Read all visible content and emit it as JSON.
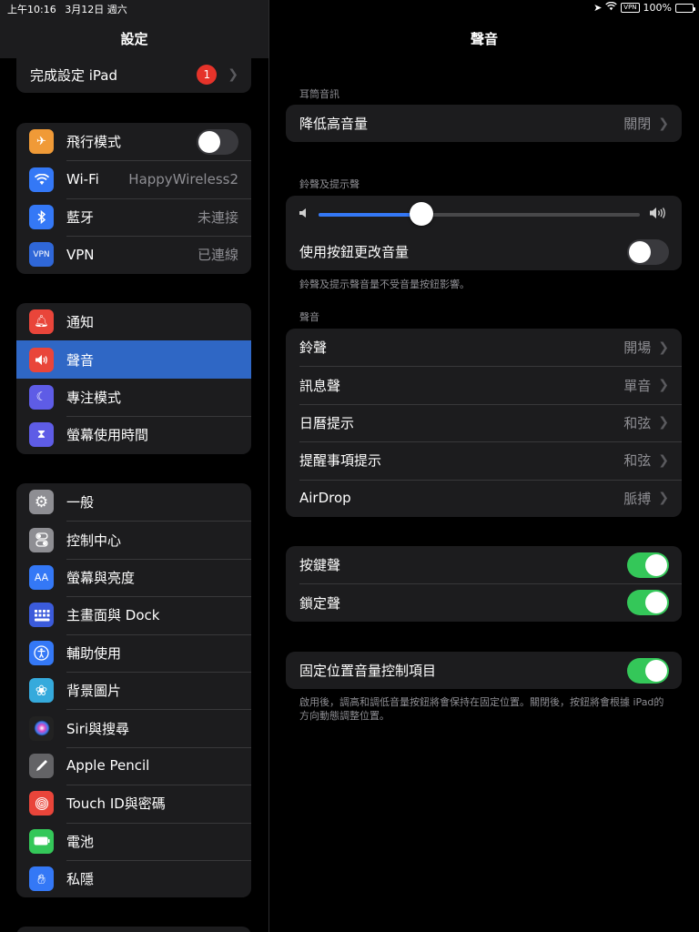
{
  "status": {
    "time": "上午10:16",
    "date": "3月12日 週六",
    "vpn": "VPN",
    "battery": "100%"
  },
  "sidebar": {
    "title": "設定",
    "setup": {
      "label": "完成設定 iPad",
      "badge": "1"
    },
    "group1": [
      {
        "label": "飛行模式",
        "icon": "airplane-icon",
        "color": "#f09a37",
        "toggle": false
      },
      {
        "label": "Wi-Fi",
        "icon": "wifi-icon",
        "color": "#3478f6",
        "value": "HappyWireless2"
      },
      {
        "label": "藍牙",
        "icon": "bluetooth-icon",
        "color": "#3478f6",
        "value": "未連接"
      },
      {
        "label": "VPN",
        "icon": "vpn-icon",
        "color": "#2f67d8",
        "value": "已連線",
        "icon_text": "VPN"
      }
    ],
    "group2": [
      {
        "label": "通知",
        "icon": "bell-icon",
        "color": "#e9453a"
      },
      {
        "label": "聲音",
        "icon": "speaker-icon",
        "color": "#e9453a",
        "selected": true
      },
      {
        "label": "專注模式",
        "icon": "moon-icon",
        "color": "#5e5ce6"
      },
      {
        "label": "螢幕使用時間",
        "icon": "hourglass-icon",
        "color": "#5e5ce6"
      }
    ],
    "group3": [
      {
        "label": "一般",
        "icon": "gear-icon",
        "color": "#8e8e93"
      },
      {
        "label": "控制中心",
        "icon": "switches-icon",
        "color": "#8e8e93"
      },
      {
        "label": "螢幕與亮度",
        "icon": "text-size-icon",
        "color": "#3478f6",
        "icon_text": "AA"
      },
      {
        "label": "主畫面與 Dock",
        "icon": "home-grid-icon",
        "color": "#3b5bdb"
      },
      {
        "label": "輔助使用",
        "icon": "accessibility-icon",
        "color": "#3478f6"
      },
      {
        "label": "背景圖片",
        "icon": "flower-icon",
        "color": "#35aadc"
      },
      {
        "label": "Siri與搜尋",
        "icon": "siri-icon",
        "color": "#222222"
      },
      {
        "label": "Apple Pencil",
        "icon": "pencil-icon",
        "color": "#636366"
      },
      {
        "label": "Touch ID與密碼",
        "icon": "fingerprint-icon",
        "color": "#e9453a"
      },
      {
        "label": "電池",
        "icon": "battery-icon",
        "color": "#34c759"
      },
      {
        "label": "私隱",
        "icon": "hand-icon",
        "color": "#3478f6"
      }
    ]
  },
  "main": {
    "title": "聲音",
    "earphone_header": "耳筒音訊",
    "reduce_loud": {
      "label": "降低高音量",
      "value": "關閉"
    },
    "ringer_header": "鈴聲及提示聲",
    "ringer_volume": 0.32,
    "change_with_buttons": {
      "label": "使用按鈕更改音量",
      "on": false
    },
    "ringer_footer": "鈴聲及提示聲音量不受音量按鈕影響。",
    "sounds_header": "聲音",
    "sounds": [
      {
        "label": "鈴聲",
        "value": "開場"
      },
      {
        "label": "訊息聲",
        "value": "單音"
      },
      {
        "label": "日曆提示",
        "value": "和弦"
      },
      {
        "label": "提醒事項提示",
        "value": "和弦"
      },
      {
        "label": "AirDrop",
        "value": "脈搏"
      }
    ],
    "keyboard_clicks": {
      "label": "按鍵聲",
      "on": true
    },
    "lock_sound": {
      "label": "鎖定聲",
      "on": true
    },
    "fixed_volume": {
      "label": "固定位置音量控制項目",
      "on": true
    },
    "fixed_footer": "啟用後，調高和調低音量按鈕將會保持在固定位置。關閉後，按鈕將會根據 iPad的方向動態調整位置。"
  }
}
